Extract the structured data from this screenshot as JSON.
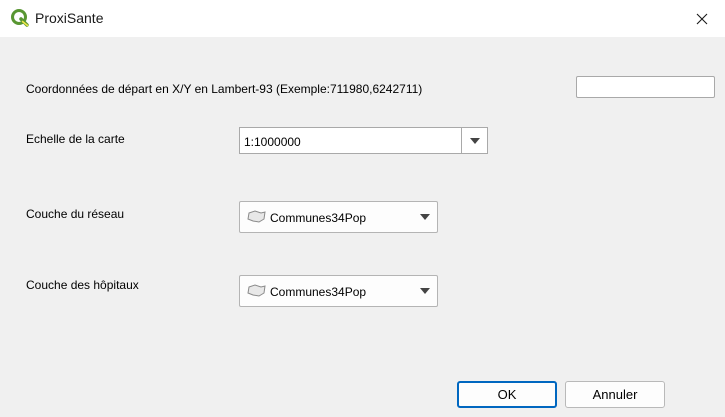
{
  "window": {
    "title": "ProxiSante",
    "icon": "qgis-logo-icon",
    "close_icon": "close-icon",
    "accent_color": "#589632"
  },
  "form": {
    "coords": {
      "label": "Coordonnées de départ en X/Y en Lambert-93 (Exemple:711980,6242711)",
      "value": ""
    },
    "scale": {
      "label": "Echelle de la carte",
      "value": "1:1000000"
    },
    "network_layer": {
      "label": "Couche du réseau",
      "value": "Communes34Pop",
      "icon": "polygon-layer-icon"
    },
    "hospital_layer": {
      "label": "Couche des hôpitaux",
      "value": "Communes34Pop",
      "icon": "polygon-layer-icon"
    }
  },
  "buttons": {
    "ok": "OK",
    "cancel": "Annuler"
  }
}
